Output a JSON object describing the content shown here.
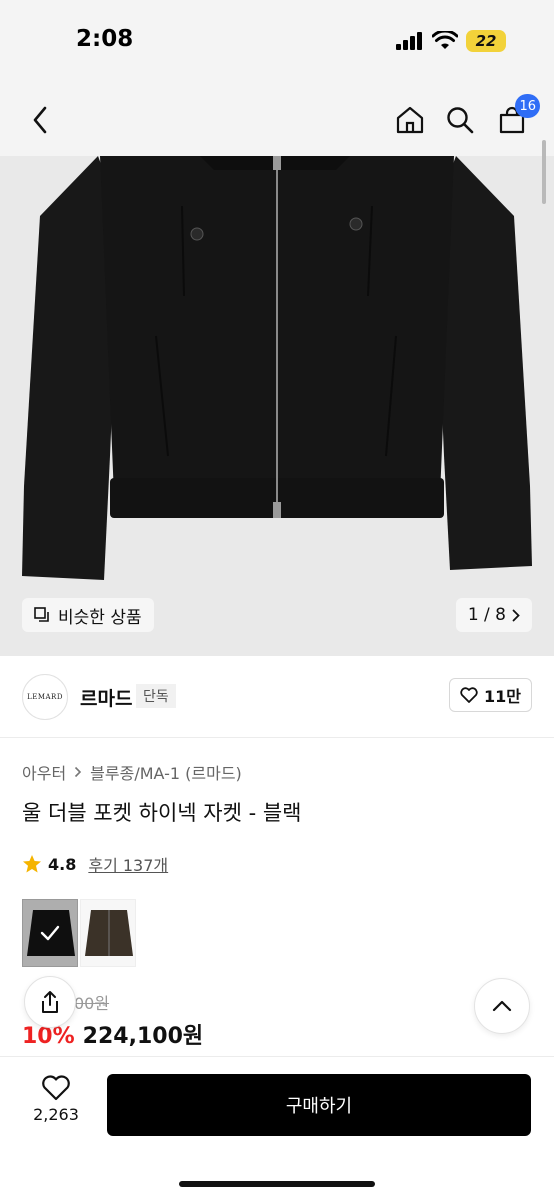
{
  "status_bar": {
    "time": "2:08",
    "battery": "22"
  },
  "nav": {
    "cart_count": "16"
  },
  "gallery": {
    "similar_label": "비슷한 상품",
    "page_indicator": "1 / 8"
  },
  "brand": {
    "logo_text": "LEMARD",
    "name": "르마드",
    "tag": "단독",
    "likes": "11만"
  },
  "breadcrumb": {
    "category": "아우터",
    "subcategory": "블루종/MA-1 (르마드)"
  },
  "product": {
    "title": "울 더블 포켓 하이넥 자켓 - 블랙",
    "rating": "4.8",
    "reviews": "후기 137개",
    "original_price": "00원",
    "discount": "10%",
    "price": "224,100원"
  },
  "bottom": {
    "wish_count": "2,263",
    "buy_label": "구매하기"
  },
  "colors": {
    "badge": "#2f6df6",
    "discount": "#ee2222",
    "star": "#f5b400",
    "buy": "#000000"
  }
}
